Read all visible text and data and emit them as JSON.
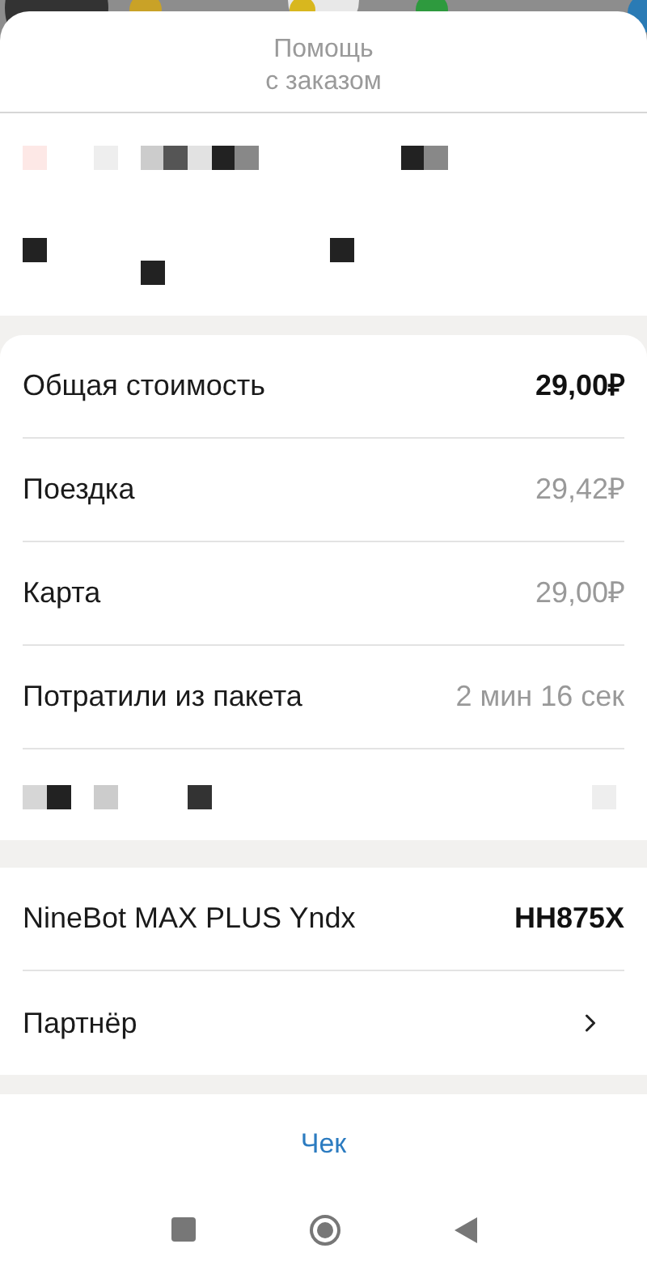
{
  "header": {
    "title_lines": [
      "Помощь",
      "с заказом"
    ]
  },
  "price_rows": [
    {
      "kind": "total",
      "label": "Общая стоимость",
      "value": "29,00₽"
    },
    {
      "kind": "detail",
      "label": "Поездка",
      "value": "29,42₽"
    },
    {
      "kind": "detail",
      "label": "Карта",
      "value": "29,00₽"
    },
    {
      "kind": "detail",
      "label": "Потратили из пакета",
      "value": "2 мин 16 сек"
    }
  ],
  "vehicle_rows": [
    {
      "kind": "value",
      "label": "NineBot MAX PLUS Yndx",
      "value": "HH875X"
    },
    {
      "kind": "link",
      "label": "Партнёр"
    }
  ],
  "receipt_link": "Чек"
}
